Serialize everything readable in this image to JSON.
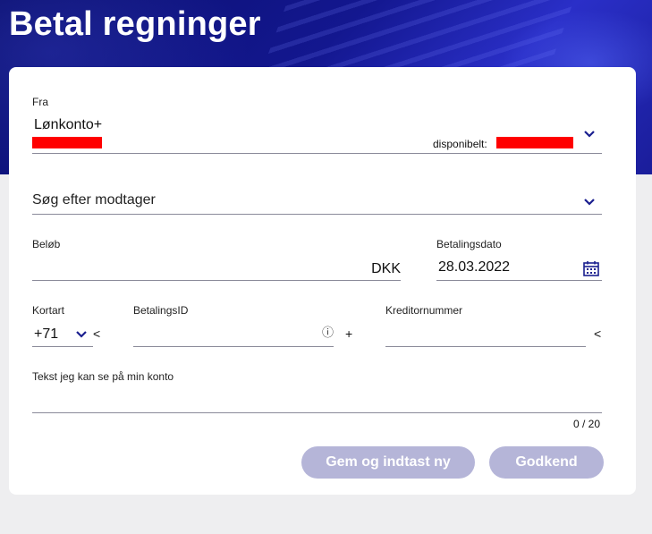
{
  "page": {
    "title": "Betal regninger"
  },
  "from": {
    "label": "Fra",
    "account_name": "Lønkonto+",
    "available_label": "disponibelt:"
  },
  "recipient": {
    "placeholder": "Søg efter modtager"
  },
  "amount": {
    "label": "Beløb",
    "currency": "DKK",
    "value": ""
  },
  "payment_date": {
    "label": "Betalingsdato",
    "value": "28.03.2022"
  },
  "card_type": {
    "label": "Kortart",
    "value": "+71",
    "suffix": "<"
  },
  "payment_id": {
    "label": "BetalingsID",
    "info": "ⓘ",
    "suffix": "+"
  },
  "creditor_number": {
    "label": "Kreditornummer",
    "suffix": "<"
  },
  "own_text": {
    "label": "Tekst jeg kan se på min konto",
    "counter": "0 / 20"
  },
  "actions": {
    "save_new": "Gem og indtast ny",
    "approve": "Godkend"
  },
  "colors": {
    "brand_dark": "#0a0f6e",
    "button_disabled": "#b5b5d8",
    "redaction": "#ff0000"
  }
}
